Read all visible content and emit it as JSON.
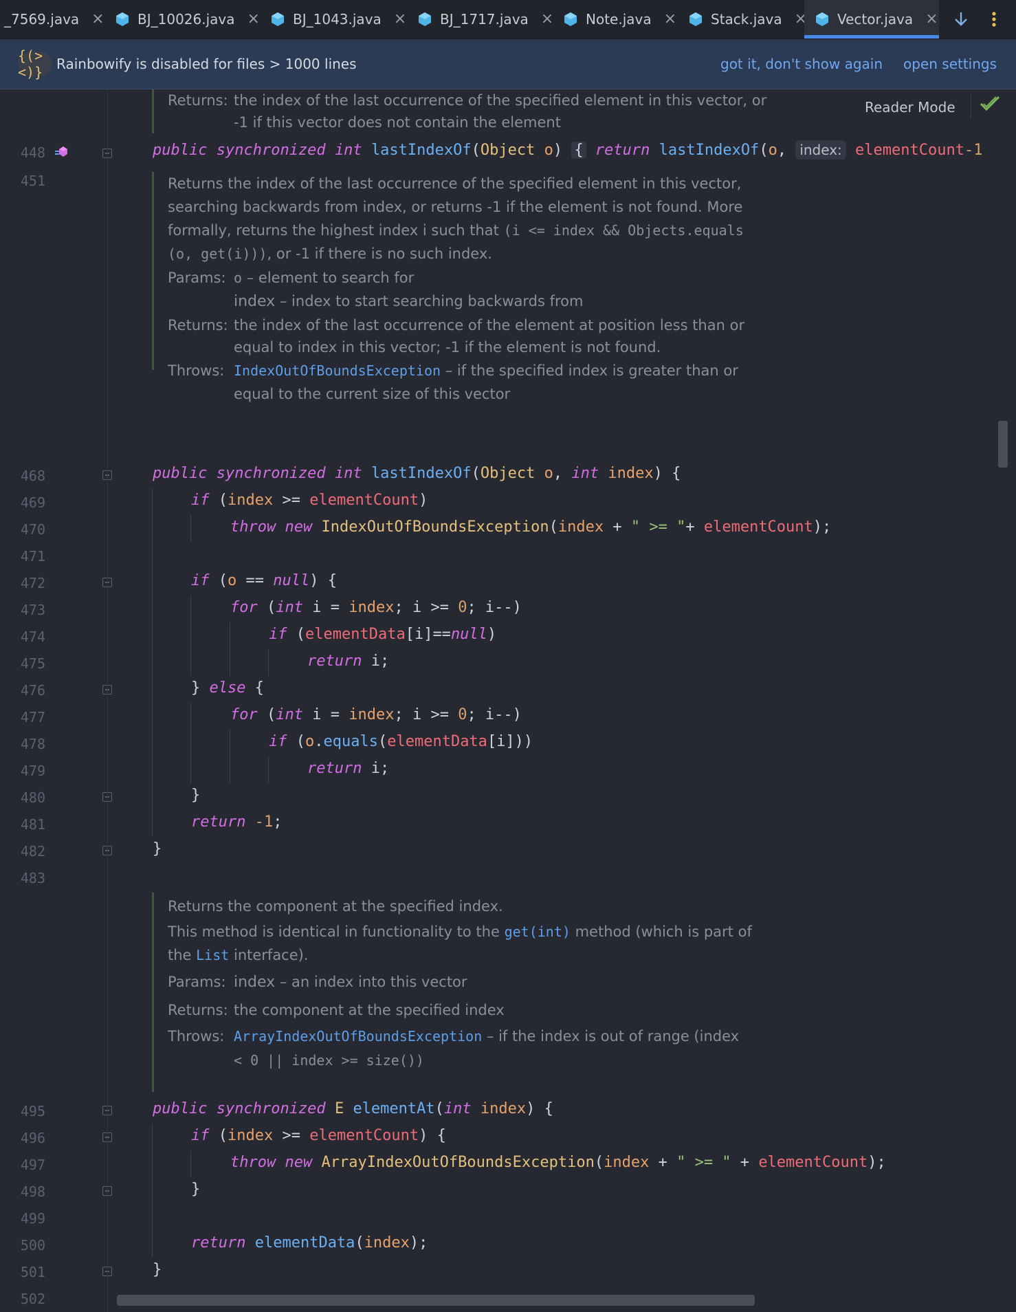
{
  "tabs": [
    {
      "label": "_7569.java",
      "active": false
    },
    {
      "label": "BJ_10026.java",
      "active": false
    },
    {
      "label": "BJ_1043.java",
      "active": false
    },
    {
      "label": "BJ_1717.java",
      "active": false
    },
    {
      "label": "Note.java",
      "active": false
    },
    {
      "label": "Stack.java",
      "active": false
    },
    {
      "label": "Vector.java",
      "active": true
    }
  ],
  "tab_close_glyph": "×",
  "banner": {
    "icon_label": "{(><)}",
    "text": "Rainbowify is disabled for files > 1000 lines",
    "link_dismiss": "got it, don't show again",
    "link_settings": "open settings"
  },
  "reader_mode": "Reader Mode",
  "doc1": {
    "returns_label": "Returns:",
    "returns_line1": "the index of the last occurrence of the specified element in this vector, or",
    "returns_line2": "-1 if this vector does not contain the element"
  },
  "line448": {
    "num": "448",
    "inlay_hint": "index:"
  },
  "doc2": {
    "p1": "Returns the index of the last occurrence of the specified element in this vector,",
    "p2": "searching backwards from index, or returns -1 if the element is not found. More",
    "p3a": "formally, returns the highest index i such that ",
    "p3code": "(i <= index && Objects.equals",
    "p4code": "(o, get(i)))",
    "p4b": ", or -1 if there is no such index.",
    "params_label": "Params:",
    "param1_name": "o",
    "param1_desc": " – element to search for",
    "param2_name": "index",
    "param2_desc": " – index to start searching backwards from",
    "returns_label": "Returns:",
    "returns_line1": "the index of the last occurrence of the element at position less than or",
    "returns_line2": "equal to index in this vector; -1 if the element is not found.",
    "throws_label": "Throws:",
    "throws_exc": "IndexOutOfBoundsException",
    "throws_line1": " – if the specified index is greater than or",
    "throws_line2": "equal to the current size of this vector"
  },
  "doc3": {
    "p1": "Returns the component at the specified index.",
    "p2a": "This method is identical in functionality to the ",
    "p2link": "get(int)",
    "p2b": " method (which is part of",
    "p3a": "the ",
    "p3link": "List",
    "p3b": " interface).",
    "params_label": "Params:",
    "param1_name": "index",
    "param1_desc": " – an index into this vector",
    "returns_label": "Returns:",
    "returns_text": "the component at the specified index",
    "throws_label": "Throws:",
    "throws_exc": "ArrayIndexOutOfBoundsException",
    "throws_line1": " – if the index is out of range (index",
    "throws_line2": "< 0 || index >= size())"
  },
  "line_numbers": [
    "448",
    "451",
    "468",
    "469",
    "470",
    "471",
    "472",
    "473",
    "474",
    "475",
    "476",
    "477",
    "478",
    "479",
    "480",
    "481",
    "482",
    "483",
    "495",
    "496",
    "497",
    "498",
    "499",
    "500",
    "501",
    "502"
  ]
}
